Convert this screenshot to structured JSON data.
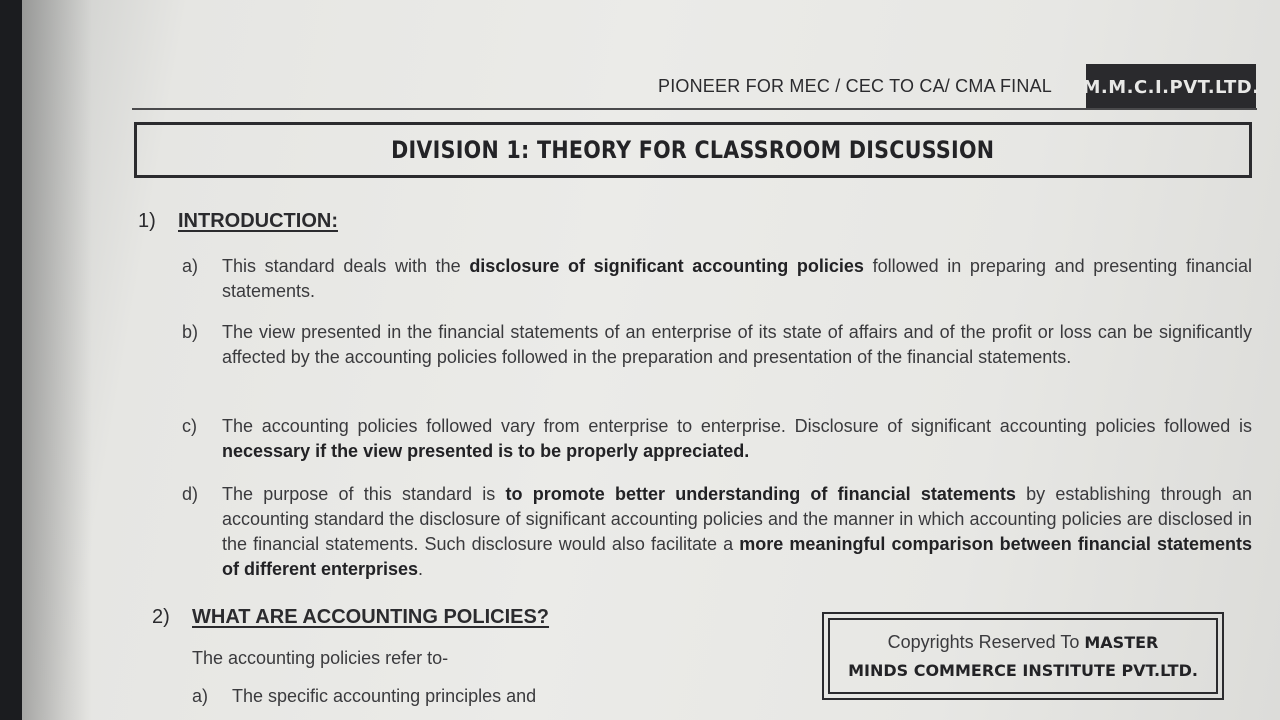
{
  "header": {
    "tagline": "PIONEER FOR MEC / CEC TO CA/ CMA FINAL",
    "badge": "M.M.C.I.PVT.LTD."
  },
  "title": "DIVISION 1: THEORY FOR CLASSROOM DISCUSSION",
  "section1": {
    "number": "1)",
    "heading": "INTRODUCTION:",
    "items": [
      {
        "label": "a)",
        "pre": "This standard deals with the ",
        "bold": "disclosure of significant accounting policies",
        "post": " followed in preparing and presenting financial statements."
      },
      {
        "label": "b)",
        "pre": "The view presented in the financial statements of an enterprise of its state of affairs and of the profit or loss can be significantly affected by the accounting policies followed in the preparation and presentation of the financial statements.",
        "bold": "",
        "post": ""
      },
      {
        "label": "c)",
        "pre": "The accounting policies followed vary from enterprise to enterprise. Disclosure of significant accounting policies followed is ",
        "bold": "necessary if the view presented is to be properly appreciated.",
        "post": ""
      },
      {
        "label": "d)",
        "pre": "The purpose of this standard is ",
        "bold": "to promote better understanding of financial statements",
        "post": " by establishing through an accounting standard the disclosure of significant accounting policies and the manner in which accounting policies are disclosed in the financial statements. Such disclosure would also facilitate a ",
        "bold2": "more meaningful comparison between financial statements of different enterprises",
        "post2": "."
      }
    ]
  },
  "section2": {
    "number": "2)",
    "heading": "WHAT ARE ACCOUNTING POLICIES?",
    "intro": "The accounting policies refer to-",
    "item_a_label": "a)",
    "item_a_text": "The specific accounting principles and"
  },
  "copyright": {
    "line1_normal": "Copyrights Reserved To ",
    "line1_bold": "MASTER",
    "line2_bold": "MINDS COMMERCE INSTITUTE PVT.LTD."
  }
}
